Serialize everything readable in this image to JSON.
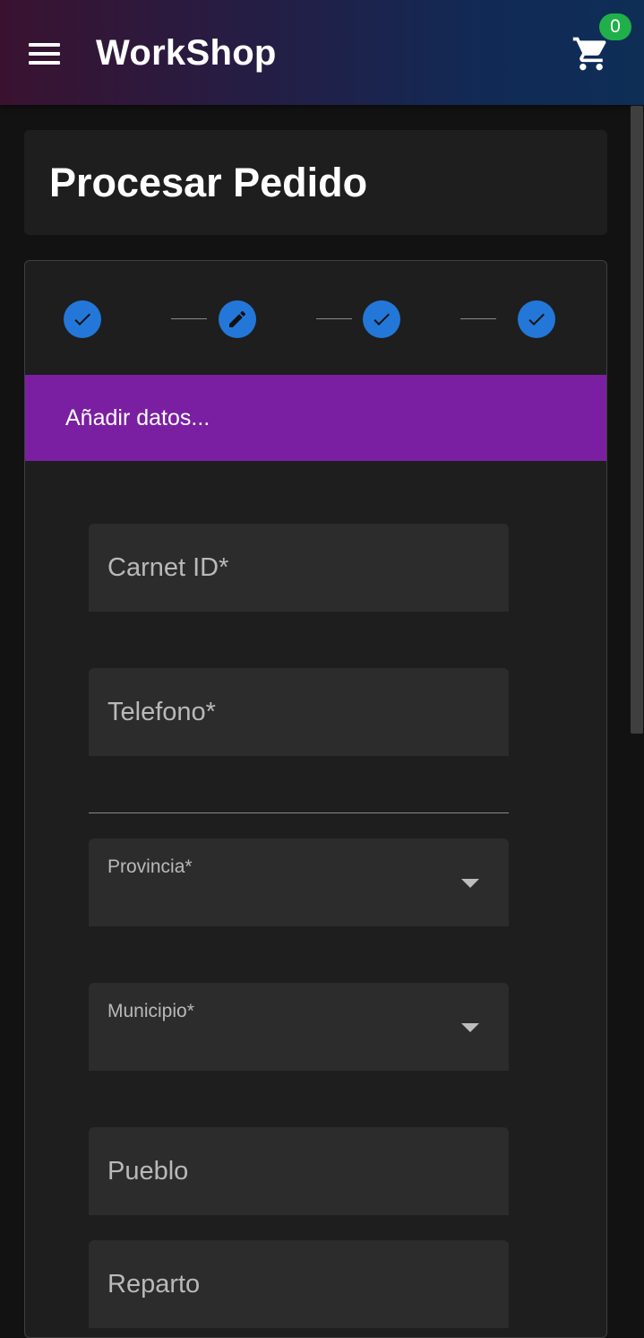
{
  "appbar": {
    "title": "WorkShop",
    "menu_icon": "menu-icon",
    "cart_icon": "shopping-cart-icon",
    "cart_count": "0"
  },
  "page": {
    "title": "Procesar Pedido"
  },
  "stepper": {
    "steps": [
      {
        "icon": "check-icon",
        "state": "completed"
      },
      {
        "icon": "pencil-icon",
        "state": "editing"
      },
      {
        "icon": "check-icon",
        "state": "completed"
      },
      {
        "icon": "check-icon",
        "state": "completed"
      }
    ],
    "step_color": "#2377d8",
    "banner_text": "Añadir datos...",
    "banner_color": "#7b1fa2"
  },
  "form": {
    "carnet_placeholder": "Carnet ID*",
    "telefono_placeholder": "Telefono*",
    "provincia_label": "Provincia*",
    "municipio_label": "Municipio*",
    "pueblo_placeholder": "Pueblo",
    "reparto_placeholder": "Reparto"
  },
  "colors": {
    "background": "#121212",
    "card": "#1e1e1e",
    "field": "#2c2c2c",
    "badge": "#20b04a"
  }
}
